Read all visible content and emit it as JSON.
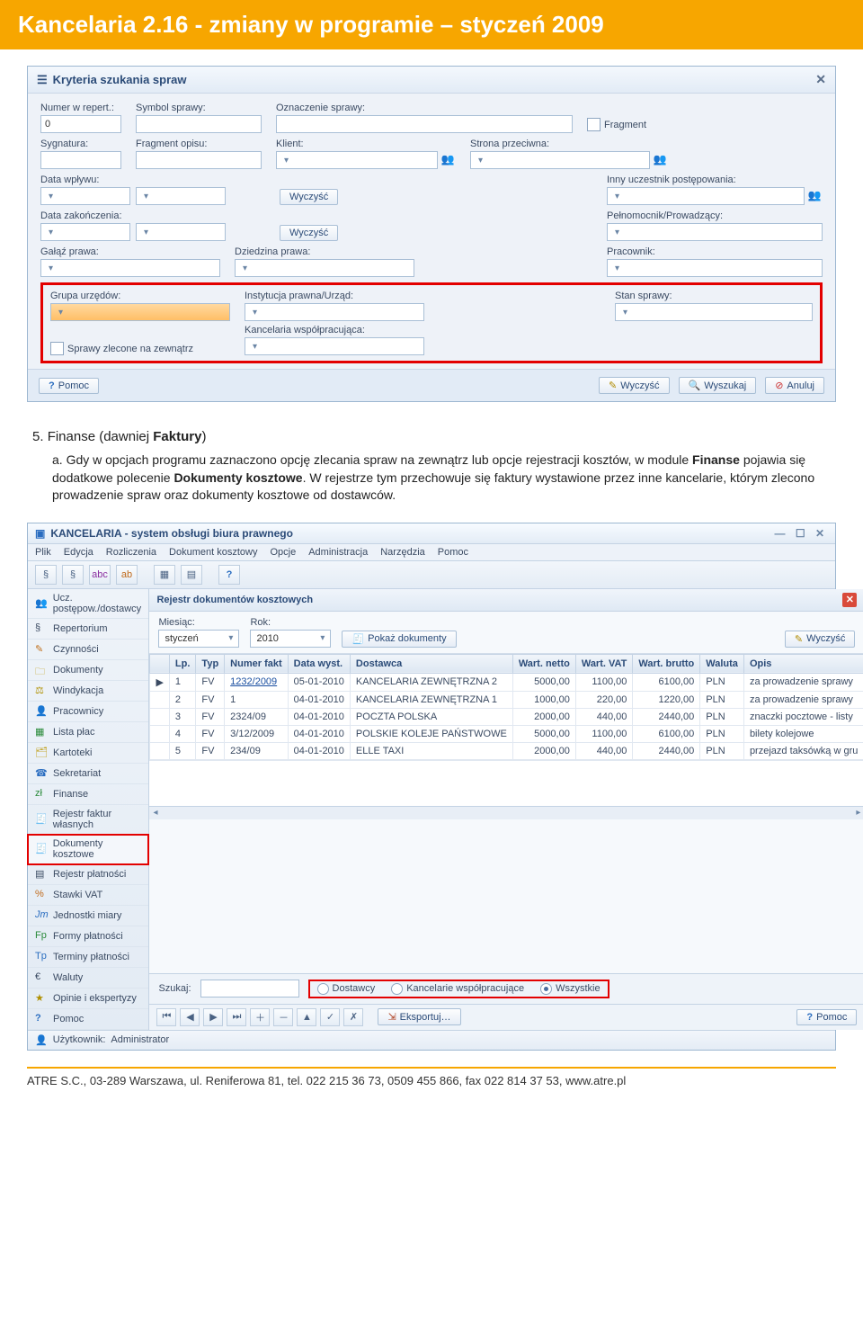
{
  "page_title": "Kancelaria 2.16 - zmiany w programie – styczeń 2009",
  "win1": {
    "title": "Kryteria szukania spraw",
    "labels": {
      "numer": "Numer w repert.:",
      "symbol": "Symbol sprawy:",
      "oznaczenie": "Oznaczenie sprawy:",
      "fragment_chk": "Fragment",
      "sygnatura": "Sygnatura:",
      "fragment_opisu": "Fragment opisu:",
      "klient": "Klient:",
      "strona": "Strona przeciwna:",
      "data_wplywu": "Data wpływu:",
      "inny_uczestnik": "Inny uczestnik postępowania:",
      "data_zakonczenia": "Data zakończenia:",
      "pelnomocnik": "Pełnomocnik/Prowadzący:",
      "galaz": "Gałąź prawa:",
      "dziedzina": "Dziedzina prawa:",
      "pracownik": "Pracownik:",
      "grupa": "Grupa urzędów:",
      "instytucja": "Instytucja prawna/Urząd:",
      "stan": "Stan sprawy:",
      "kanc_wsp": "Kancelaria współpracująca:",
      "sprawy_zlec": "Sprawy zlecone na zewnątrz"
    },
    "values": {
      "numer": "0"
    },
    "buttons": {
      "wyczysc_small": "Wyczyść",
      "pomoc": "Pomoc",
      "wyczysc": "Wyczyść",
      "wyszukaj": "Wyszukaj",
      "anuluj": "Anuluj"
    }
  },
  "paragraph": {
    "heading_num": "5.",
    "heading_text_prefix": "Finanse (dawniej ",
    "heading_text_bold": "Faktury",
    "heading_text_suffix": ")",
    "item_letter": "a.",
    "item_text_1": "Gdy w opcjach programu zaznaczono opcję zlecania spraw na zewnątrz lub opcje rejestracji kosztów, w module ",
    "item_bold_1": "Finanse",
    "item_text_2": " pojawia się dodatkowe polecenie ",
    "item_bold_2": "Dokumenty kosztowe",
    "item_text_3": ". W rejestrze tym przechowuje się faktury wystawione przez inne kancelarie, którym zlecono prowadzenie spraw oraz dokumenty kosztowe od dostawców."
  },
  "win2": {
    "caption": "KANCELARIA - system obsługi biura prawnego",
    "menu": [
      "Plik",
      "Edycja",
      "Rozliczenia",
      "Dokument kosztowy",
      "Opcje",
      "Administracja",
      "Narzędzia",
      "Pomoc"
    ],
    "nav": [
      "Ucz. postępow./dostawcy",
      "Repertorium",
      "Czynności",
      "Dokumenty",
      "Windykacja",
      "Pracownicy",
      "Lista płac",
      "Kartoteki",
      "Sekretariat",
      "Finanse",
      "Rejestr faktur własnych",
      "Dokumenty kosztowe",
      "Rejestr płatności",
      "Stawki VAT",
      "Jednostki miary",
      "Formy płatności",
      "Terminy płatności",
      "Waluty",
      "Opinie i ekspertyzy",
      "Pomoc"
    ],
    "panel_title": "Rejestr dokumentów kosztowych",
    "filter": {
      "miesiac_label": "Miesiąc:",
      "miesiac_value": "styczeń",
      "rok_label": "Rok:",
      "rok_value": "2010",
      "pokaz": "Pokaż dokumenty",
      "wyczysc": "Wyczyść"
    },
    "columns": [
      "Lp.",
      "Typ",
      "Numer fakt",
      "Data wyst.",
      "Dostawca",
      "Wart. netto",
      "Wart. VAT",
      "Wart. brutto",
      "Waluta",
      "Opis"
    ],
    "rows": [
      {
        "lp": "1",
        "typ": "FV",
        "nr": "1232/2009",
        "data": "05-01-2010",
        "dost": "KANCELARIA ZEWNĘTRZNA 2",
        "netto": "5000,00",
        "vat": "1100,00",
        "brutto": "6100,00",
        "wal": "PLN",
        "opis": "za prowadzenie sprawy"
      },
      {
        "lp": "2",
        "typ": "FV",
        "nr": "1",
        "data": "04-01-2010",
        "dost": "KANCELARIA ZEWNĘTRZNA 1",
        "netto": "1000,00",
        "vat": "220,00",
        "brutto": "1220,00",
        "wal": "PLN",
        "opis": "za prowadzenie sprawy"
      },
      {
        "lp": "3",
        "typ": "FV",
        "nr": "2324/09",
        "data": "04-01-2010",
        "dost": "POCZTA POLSKA",
        "netto": "2000,00",
        "vat": "440,00",
        "brutto": "2440,00",
        "wal": "PLN",
        "opis": "znaczki pocztowe - listy"
      },
      {
        "lp": "4",
        "typ": "FV",
        "nr": "3/12/2009",
        "data": "04-01-2010",
        "dost": "POLSKIE KOLEJE PAŃSTWOWE",
        "netto": "5000,00",
        "vat": "1100,00",
        "brutto": "6100,00",
        "wal": "PLN",
        "opis": "bilety kolejowe"
      },
      {
        "lp": "5",
        "typ": "FV",
        "nr": "234/09",
        "data": "04-01-2010",
        "dost": "ELLE TAXI",
        "netto": "2000,00",
        "vat": "440,00",
        "brutto": "2440,00",
        "wal": "PLN",
        "opis": "przejazd taksówką w gru"
      }
    ],
    "search_label": "Szukaj:",
    "radios": {
      "dostawcy": "Dostawcy",
      "kanc": "Kancelarie współpracujące",
      "wszystkie": "Wszystkie"
    },
    "export": "Eksportuj…",
    "pomoc": "Pomoc",
    "status_user_label": "Użytkownik:",
    "status_user_value": "Administrator"
  },
  "footer": {
    "text_prefix": "ATRE S.C., 03-289 Warszawa, ul. Reniferowa 81, tel. 022 215 36 73, 0509 455 866, fax 022 814 37 53, ",
    "link": "www.atre.pl"
  }
}
